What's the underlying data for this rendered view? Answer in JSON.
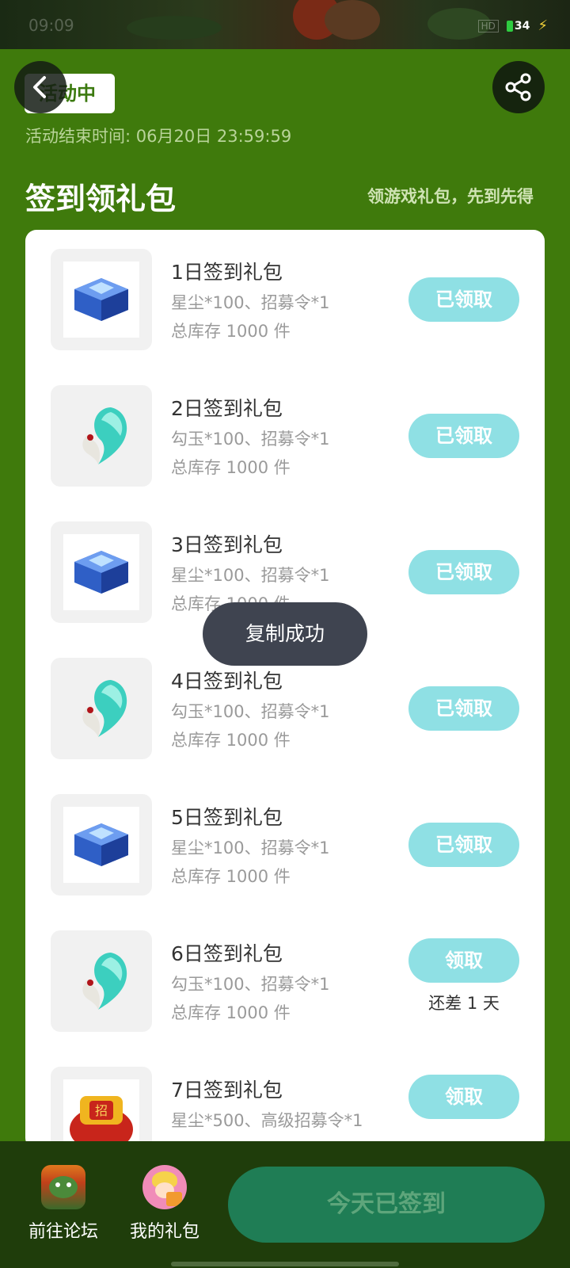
{
  "status_bar": {
    "time": "09:09",
    "network": "HD",
    "battery": "34"
  },
  "header": {
    "status_tag": "活动中",
    "end_time": "活动结束时间: 06月20日 23:59:59",
    "icons": {
      "back": "chevron-left-icon",
      "share": "share-icon"
    }
  },
  "section": {
    "title": "签到领礼包",
    "subtitle": "领游戏礼包，先到先得"
  },
  "gifts": [
    {
      "name": "1日签到礼包",
      "desc": "星尘*100、招募令*1",
      "stock": "总库存 1000 件",
      "button": "已领取",
      "note": "",
      "icon": "crystal-chest-icon"
    },
    {
      "name": "2日签到礼包",
      "desc": "勾玉*100、招募令*1",
      "stock": "总库存 1000 件",
      "button": "已领取",
      "note": "",
      "icon": "jade-magatama-icon"
    },
    {
      "name": "3日签到礼包",
      "desc": "星尘*100、招募令*1",
      "stock": "总库存 1000 件",
      "button": "已领取",
      "note": "",
      "icon": "crystal-chest-icon"
    },
    {
      "name": "4日签到礼包",
      "desc": "勾玉*100、招募令*1",
      "stock": "总库存 1000 件",
      "button": "已领取",
      "note": "",
      "icon": "jade-magatama-icon"
    },
    {
      "name": "5日签到礼包",
      "desc": "星尘*100、招募令*1",
      "stock": "总库存 1000 件",
      "button": "已领取",
      "note": "",
      "icon": "crystal-chest-icon"
    },
    {
      "name": "6日签到礼包",
      "desc": "勾玉*100、招募令*1",
      "stock": "总库存 1000 件",
      "button": "领取",
      "note": "还差 1 天",
      "icon": "jade-magatama-icon"
    },
    {
      "name": "7日签到礼包",
      "desc": "星尘*500、高级招募令*1",
      "stock": "",
      "button": "领取",
      "note": "",
      "icon": "golden-treasure-icon"
    }
  ],
  "toast": "复制成功",
  "bottom_bar": {
    "forum_label": "前往论坛",
    "my_gifts_label": "我的礼包",
    "checkin_button": "今天已签到"
  },
  "colors": {
    "page_bg": "#3f7a0c",
    "bottom_bar_bg": "#1f3d0b",
    "claim_button": "#8fe0e4",
    "checkin_button": "#1f7d55"
  }
}
